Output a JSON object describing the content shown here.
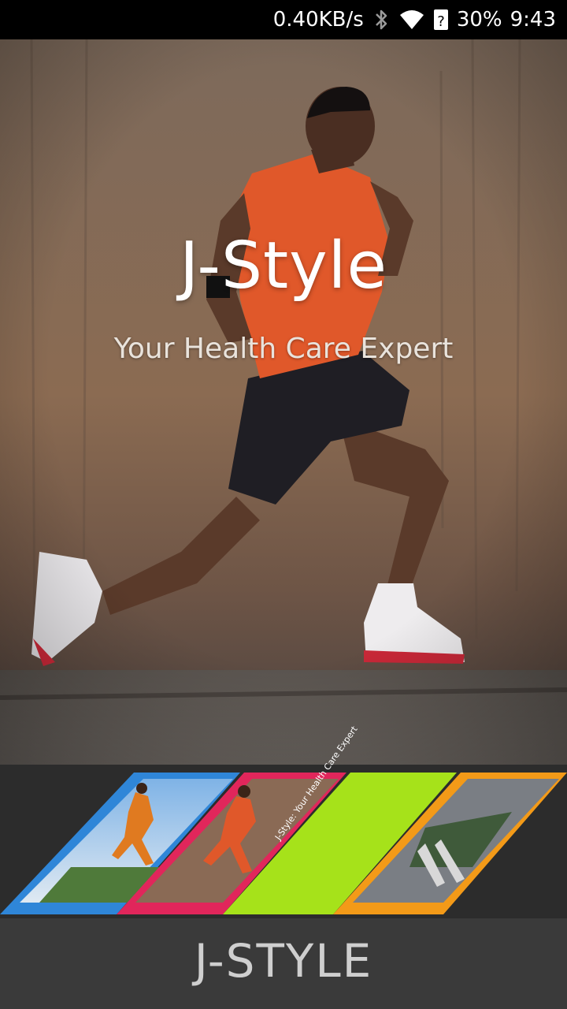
{
  "status_bar": {
    "speed": "0.40KB/s",
    "battery": "30%",
    "time": "9:43",
    "icons": [
      "bluetooth-icon",
      "wifi-icon",
      "sim-unknown-icon"
    ]
  },
  "hero": {
    "title": "J-Style",
    "subtitle": "Your Health Care Expert"
  },
  "strip": {
    "panel_colors": [
      "#2f86d8",
      "#e1265b",
      "#a6e21a",
      "#f39a18"
    ],
    "banner_text": "J-Style: Your Health Care Expert"
  },
  "footer": {
    "logo": "J-STYLE"
  }
}
